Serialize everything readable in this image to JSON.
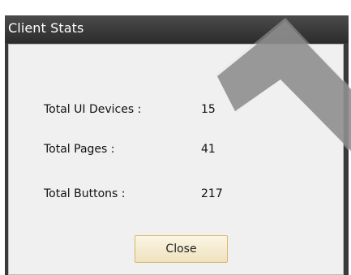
{
  "dialog": {
    "title": "Client Stats",
    "stats": [
      {
        "label": "Total UI Devices :",
        "value": "15"
      },
      {
        "label": "Total Pages :",
        "value": "41"
      },
      {
        "label": "Total Buttons :",
        "value": "217"
      }
    ],
    "close_label": "Close"
  },
  "colors": {
    "titlebar": "#3a3a3a",
    "body": "#f0f0f0",
    "button_border": "#d8b865"
  }
}
